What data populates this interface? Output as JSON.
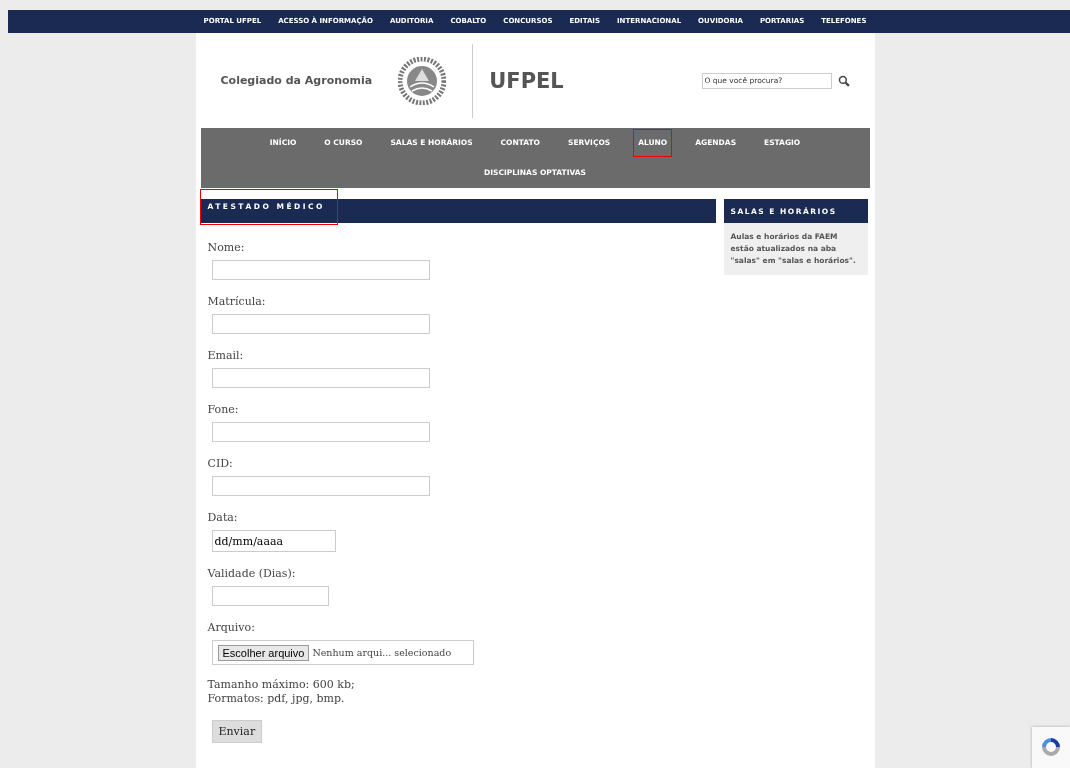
{
  "top_bar": {
    "links": [
      "PORTAL UFPEL",
      "ACESSO À INFORMAÇÃO",
      "AUDITORIA",
      "COBALTO",
      "CONCURSOS",
      "EDITAIS",
      "INTERNACIONAL",
      "OUVIDORIA",
      "PORTARIAS",
      "TELEFONES"
    ]
  },
  "header": {
    "site_title": "Colegiado da Agronomia",
    "brand": "UFPEL",
    "search": {
      "placeholder": "O que você procura?"
    }
  },
  "nav": {
    "items": [
      {
        "label": "INÍCIO",
        "highlighted": false
      },
      {
        "label": "O CURSO",
        "highlighted": false
      },
      {
        "label": "SALAS E HORÁRIOS",
        "highlighted": false
      },
      {
        "label": "CONTATO",
        "highlighted": false
      },
      {
        "label": "SERVIÇOS",
        "highlighted": false
      },
      {
        "label": "ALUNO",
        "highlighted": true
      },
      {
        "label": "AGENDAS",
        "highlighted": false
      },
      {
        "label": "ESTAGIO",
        "highlighted": false
      },
      {
        "label": "DISCIPLINAS OPTATIVAS",
        "highlighted": false
      }
    ]
  },
  "main": {
    "title": "ATESTADO MÉDICO",
    "title_highlighted": true,
    "fields": [
      {
        "kind": "text",
        "label": "Nome:"
      },
      {
        "kind": "text",
        "label": "Matrícula:"
      },
      {
        "kind": "text",
        "label": "Email:"
      },
      {
        "kind": "text",
        "label": "Fone:"
      },
      {
        "kind": "text",
        "label": "CID:"
      },
      {
        "kind": "date",
        "label": "Data:",
        "value": "dd/mm/aaaa"
      },
      {
        "kind": "number",
        "label": "Validade (Dias):"
      },
      {
        "kind": "file",
        "label": "Arquivo:",
        "button": "Escolher arquivo",
        "status": "Nenhum arqui... selecionado"
      }
    ],
    "notes": [
      "Tamanho máximo: 600 kb;",
      "Formatos: pdf, jpg, bmp."
    ],
    "submit": "Enviar"
  },
  "sidebar": {
    "title": "SALAS E HORÁRIOS",
    "text": "Aulas e horários da FAEM estão atualizados na aba \"salas\" em \"salas e horários\"."
  }
}
